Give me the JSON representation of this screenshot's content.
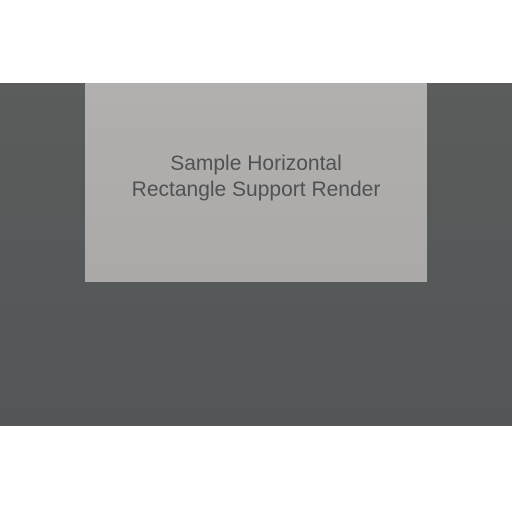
{
  "render": {
    "background_color": "#575959",
    "panel_color": "#afadab",
    "text_color": "#505152",
    "caption_lines": [
      "Sample Horizontal",
      "Rectangle Support Render"
    ]
  }
}
